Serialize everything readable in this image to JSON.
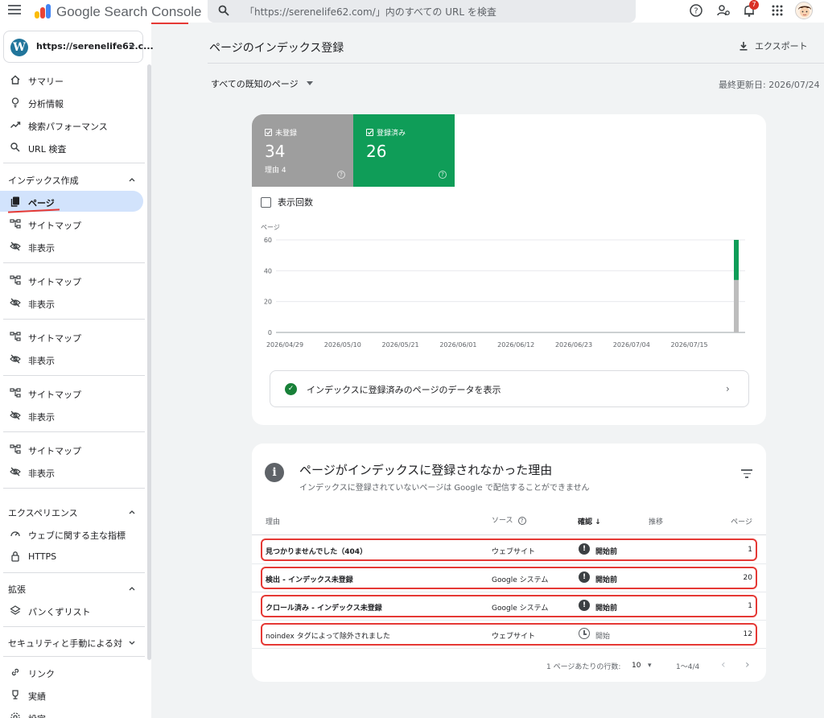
{
  "app": {
    "brand": "Google Search Console",
    "search_placeholder": "「https://serenelife62.com/」内のすべての URL を検査",
    "notification_count": "7"
  },
  "sidebar": {
    "property": "https://serenelife62.c...",
    "items_top": [
      {
        "label": "サマリー",
        "icon": "home-icon"
      },
      {
        "label": "分析情報",
        "icon": "lightbulb-icon"
      },
      {
        "label": "検索パフォーマンス",
        "icon": "trending-icon"
      },
      {
        "label": "URL 検査",
        "icon": "search-icon"
      }
    ],
    "indexing_header": "インデックス作成",
    "indexing_items": [
      {
        "label": "ページ",
        "icon": "pages-icon"
      },
      {
        "label": "サイトマップ",
        "icon": "sitemap-icon"
      },
      {
        "label": "非表示",
        "icon": "hidden-icon"
      }
    ],
    "repeat_groups": [
      {
        "sitemap": "サイトマップ",
        "hidden": "非表示"
      },
      {
        "sitemap": "サイトマップ",
        "hidden": "非表示"
      },
      {
        "sitemap": "サイトマップ",
        "hidden": "非表示"
      },
      {
        "sitemap": "サイトマップ",
        "hidden": "非表示"
      }
    ],
    "experience_header": "エクスペリエンス",
    "experience_items": [
      {
        "label": "ウェブに関する主な指標",
        "icon": "speed-icon"
      },
      {
        "label": "HTTPS",
        "icon": "lock-icon"
      }
    ],
    "enhancements_header": "拡張",
    "enhancements_items": [
      {
        "label": "パンくずリスト",
        "icon": "layers-icon"
      }
    ],
    "security_header": "セキュリティと手動による対策",
    "bottom_items": [
      {
        "label": "リンク",
        "icon": "link-icon"
      },
      {
        "label": "実績",
        "icon": "trophy-icon"
      },
      {
        "label": "設定",
        "icon": "settings-icon"
      }
    ]
  },
  "main": {
    "title": "ページのインデックス登録",
    "export_label": "エクスポート",
    "filter_label": "すべての既知のページ",
    "last_updated": "最終更新日: 2026/07/24"
  },
  "summary": {
    "not_indexed": {
      "label": "未登録",
      "value": "34",
      "sub": "理由 4",
      "color": "#9e9e9e"
    },
    "indexed": {
      "label": "登録済み",
      "value": "26",
      "color": "#0f9d58"
    },
    "impressions_label": "表示回数",
    "view_data_label": "インデックスに登録済みのページのデータを表示"
  },
  "chart_data": {
    "type": "bar",
    "ylabel": "ページ",
    "ylim": [
      0,
      60
    ],
    "yticks": [
      0,
      20,
      40,
      60
    ],
    "xticks": [
      "2026/04/29",
      "2026/05/10",
      "2026/05/21",
      "2026/06/01",
      "2026/06/12",
      "2026/06/23",
      "2026/07/04",
      "2026/07/15"
    ],
    "x_end": "2026/07/24",
    "series": [
      {
        "name": "未登録",
        "color": "#bdbdbd",
        "values": [
          34
        ]
      },
      {
        "name": "登録済み",
        "color": "#0f9d58",
        "values": [
          26
        ]
      }
    ],
    "grid": true
  },
  "reasons": {
    "title": "ページがインデックスに登録されなかった理由",
    "subtitle": "インデックスに登録されていないページは Google で配信することができません",
    "columns": {
      "reason": "理由",
      "source": "ソース",
      "validation": "確認",
      "trend": "推移",
      "pages": "ページ"
    },
    "rows": [
      {
        "reason": "見つかりませんでした（404）",
        "source": "ウェブサイト",
        "status": "開始前",
        "pages": "1"
      },
      {
        "reason": "検出 - インデックス未登録",
        "source": "Google システム",
        "status": "開始前",
        "pages": "20"
      },
      {
        "reason": "クロール済み - インデックス未登録",
        "source": "Google システム",
        "status": "開始前",
        "pages": "1"
      },
      {
        "reason": "noindex タグによって除外されました",
        "source": "ウェブサイト",
        "status": "開始",
        "pages": "12"
      }
    ],
    "pager": {
      "rows_label": "1 ページあたりの行数:",
      "rows_value": "10",
      "range": "1〜4/4"
    }
  }
}
